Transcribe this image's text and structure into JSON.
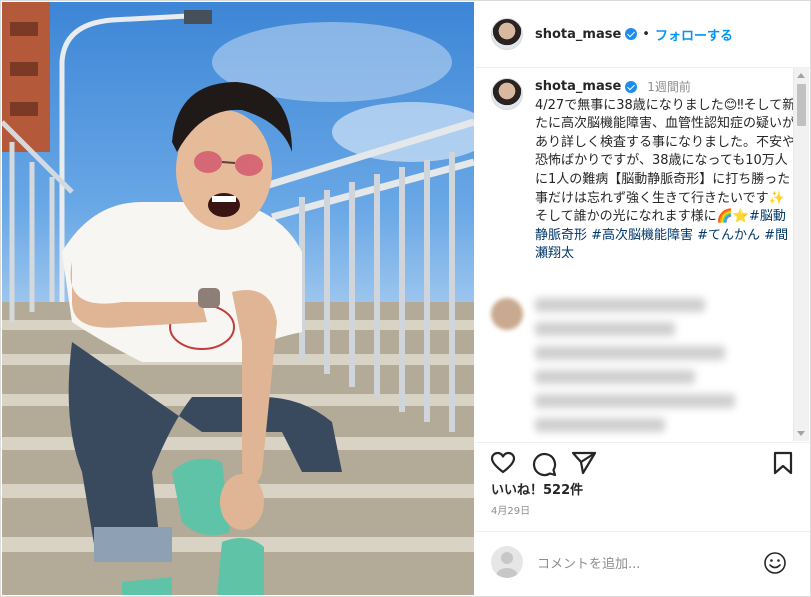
{
  "post": {
    "username": "shota_mase",
    "follow_label": "フォローする",
    "separator": "•",
    "caption_time": "1週間前",
    "caption_text": "4/27で無事に38歳になりました😊‼そして新たに高次脳機能障害、血管性認知症の疑いがあり詳しく検査する事になりました。不安や恐怖ばかりですが、38歳になっても10万人に1人の難病【脳動静脈奇形】に打ち勝った事だけは忘れず強く生きて行きたいです✨そして誰かの光になれます様に🌈⭐",
    "hashtags": "#脳動静脈奇形 #高次脳機能障害 #てんかん #間瀬翔太",
    "likes": "いいね！522件",
    "date": "4月29日",
    "comment_placeholder": "コメントを追加...",
    "accent_color": "#0095f6",
    "verified_color": "#1d8cf0"
  },
  "icons": {
    "like": "heart-icon",
    "comment": "comment-bubble-icon",
    "share": "paper-plane-icon",
    "save": "bookmark-icon",
    "emoji": "smiley-icon"
  }
}
